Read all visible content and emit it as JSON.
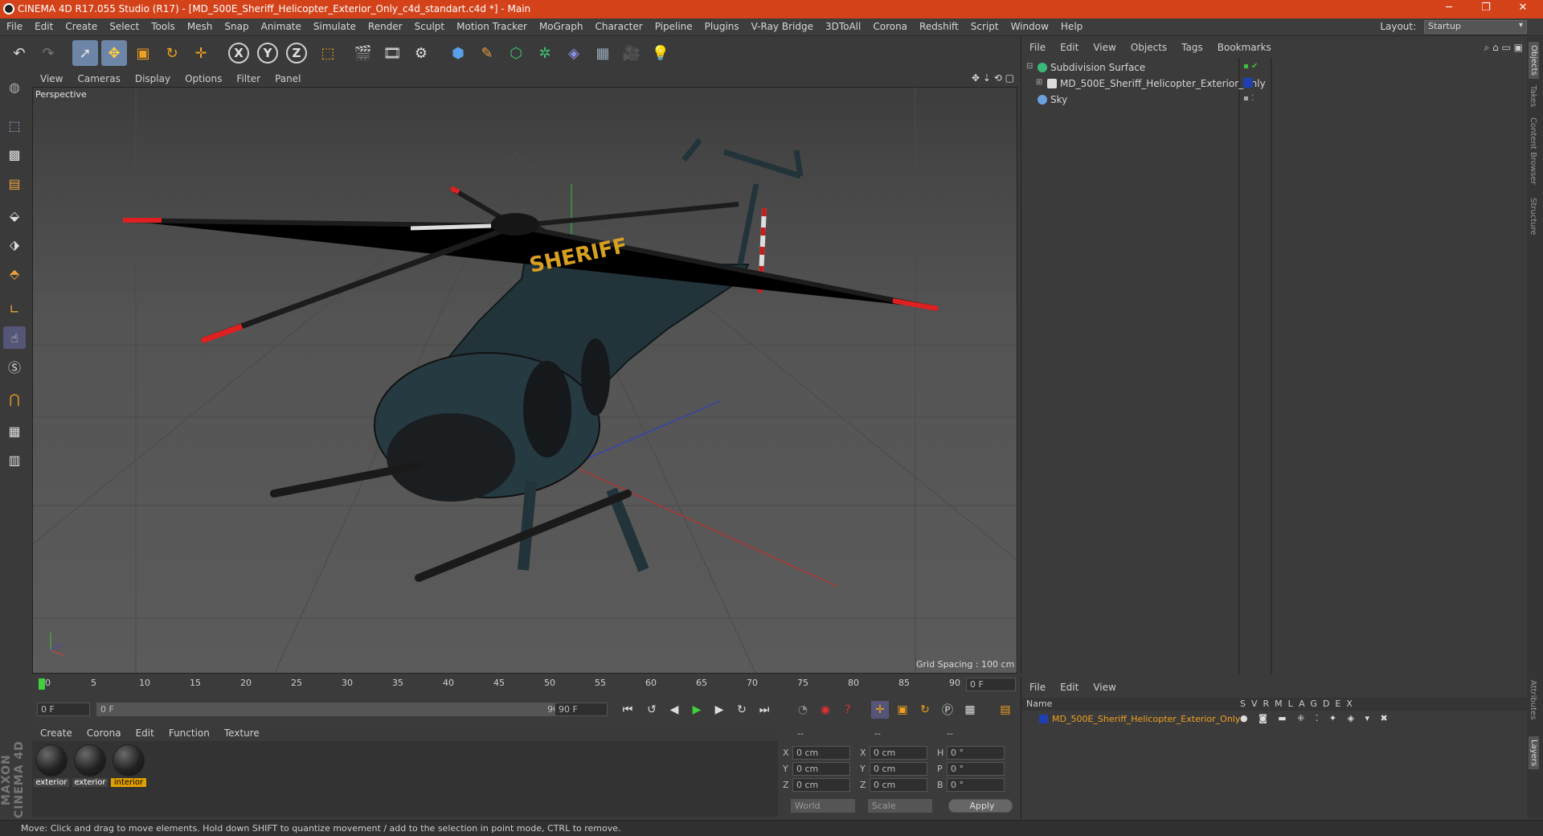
{
  "window": {
    "title": "CINEMA 4D R17.055 Studio (R17) - [MD_500E_Sheriff_Helicopter_Exterior_Only_c4d_standart.c4d *] - Main",
    "min": "─",
    "max": "❐",
    "close": "✕"
  },
  "menu": [
    "File",
    "Edit",
    "Create",
    "Select",
    "Tools",
    "Mesh",
    "Snap",
    "Animate",
    "Simulate",
    "Render",
    "Sculpt",
    "Motion Tracker",
    "MoGraph",
    "Character",
    "Pipeline",
    "Plugins",
    "V-Ray Bridge",
    "3DToAll",
    "Corona",
    "Redshift",
    "Script",
    "Window",
    "Help"
  ],
  "layout": {
    "label": "Layout:",
    "value": "Startup"
  },
  "toolbar": {
    "x": "X",
    "y": "Y",
    "z": "Z"
  },
  "viewport": {
    "menu": [
      "View",
      "Cameras",
      "Display",
      "Options",
      "Filter",
      "Panel"
    ],
    "label": "Perspective",
    "grid_spacing": "Grid Spacing : 100 cm",
    "model_text": "SHERIFF"
  },
  "timeline": {
    "ticks": [
      "0",
      "5",
      "10",
      "15",
      "20",
      "25",
      "30",
      "35",
      "40",
      "45",
      "50",
      "55",
      "60",
      "65",
      "70",
      "75",
      "80",
      "85",
      "90"
    ],
    "current_frame": "0 F"
  },
  "playback": {
    "start": "0 F",
    "slider_start": "0 F",
    "slider_end": "90 F",
    "end": "90 F"
  },
  "materials": {
    "menu": [
      "Create",
      "Corona",
      "Edit",
      "Function",
      "Texture"
    ],
    "items": [
      {
        "name": "exterior",
        "active": false
      },
      {
        "name": "exterior",
        "active": false
      },
      {
        "name": "interior",
        "active": true
      }
    ]
  },
  "coords": {
    "header": [
      "--",
      "--",
      "--"
    ],
    "rows": [
      {
        "a": "X",
        "av": "0 cm",
        "b": "X",
        "bv": "0 cm",
        "c": "H",
        "cv": "0 °"
      },
      {
        "a": "Y",
        "av": "0 cm",
        "b": "Y",
        "bv": "0 cm",
        "c": "P",
        "cv": "0 °"
      },
      {
        "a": "Z",
        "av": "0 cm",
        "b": "Z",
        "bv": "0 cm",
        "c": "B",
        "cv": "0 °"
      }
    ],
    "world": "World",
    "scale": "Scale",
    "apply": "Apply"
  },
  "objects": {
    "menu": [
      "File",
      "Edit",
      "View",
      "Objects",
      "Tags",
      "Bookmarks"
    ],
    "items": [
      {
        "name": "Subdivision Surface",
        "icon_color": "#3cb878"
      },
      {
        "name": "MD_500E_Sheriff_Helicopter_Exterior_Only",
        "icon_color": "#dddddd"
      },
      {
        "name": "Sky",
        "icon_color": "#6aa0e0"
      }
    ]
  },
  "layers": {
    "menu": [
      "File",
      "Edit",
      "View"
    ],
    "header_name": "Name",
    "columns": [
      "S",
      "V",
      "R",
      "M",
      "L",
      "A",
      "G",
      "D",
      "E",
      "X"
    ],
    "row_name": "MD_500E_Sheriff_Helicopter_Exterior_Only"
  },
  "side_tabs": [
    "Objects",
    "Takes",
    "Content Browser",
    "Structure"
  ],
  "side_tabs_bottom": [
    "Attributes",
    "Layers"
  ],
  "maxon": "MAXON CINEMA 4D",
  "status": "Move: Click and drag to move elements. Hold down SHIFT to quantize movement / add to the selection in point mode, CTRL to remove."
}
